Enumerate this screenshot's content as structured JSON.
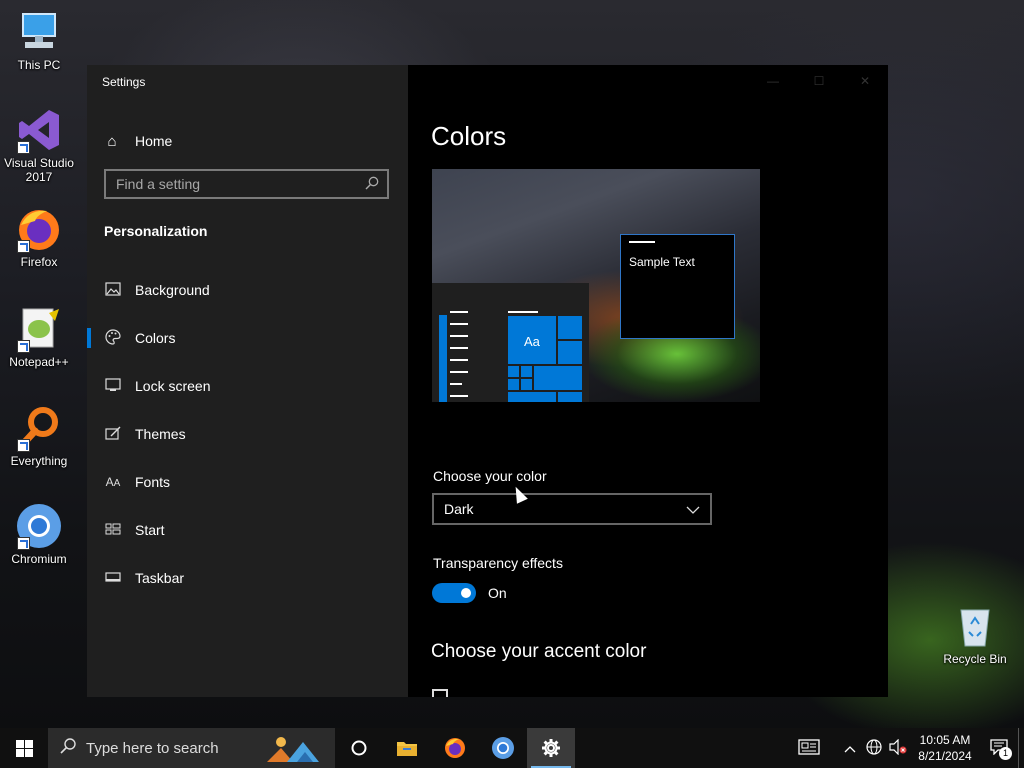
{
  "desktop": {
    "icons": [
      {
        "label": "This PC"
      },
      {
        "label": "Visual Studio 2017"
      },
      {
        "label": "Firefox"
      },
      {
        "label": "Notepad++"
      },
      {
        "label": "Everything"
      },
      {
        "label": "Chromium"
      },
      {
        "label": "Recycle Bin"
      }
    ]
  },
  "settings": {
    "window_title": "Settings",
    "home_label": "Home",
    "search_placeholder": "Find a setting",
    "section": "Personalization",
    "nav_items": [
      {
        "label": "Background",
        "icon": "image-icon"
      },
      {
        "label": "Colors",
        "icon": "palette-icon",
        "active": true
      },
      {
        "label": "Lock screen",
        "icon": "lock-screen-icon"
      },
      {
        "label": "Themes",
        "icon": "themes-icon"
      },
      {
        "label": "Fonts",
        "icon": "fonts-icon"
      },
      {
        "label": "Start",
        "icon": "start-icon"
      },
      {
        "label": "Taskbar",
        "icon": "taskbar-icon"
      }
    ],
    "page_title": "Colors",
    "preview": {
      "sample_text": "Sample Text",
      "tile_text": "Aa"
    },
    "choose_color_label": "Choose your color",
    "choose_color_value": "Dark",
    "transparency_label": "Transparency effects",
    "transparency_value": "On",
    "accent_title": "Choose your accent color",
    "accent_color": "#0078d7"
  },
  "taskbar": {
    "search_placeholder": "Type here to search",
    "time": "10:05 AM",
    "date": "8/21/2024",
    "notification_count": "1"
  }
}
